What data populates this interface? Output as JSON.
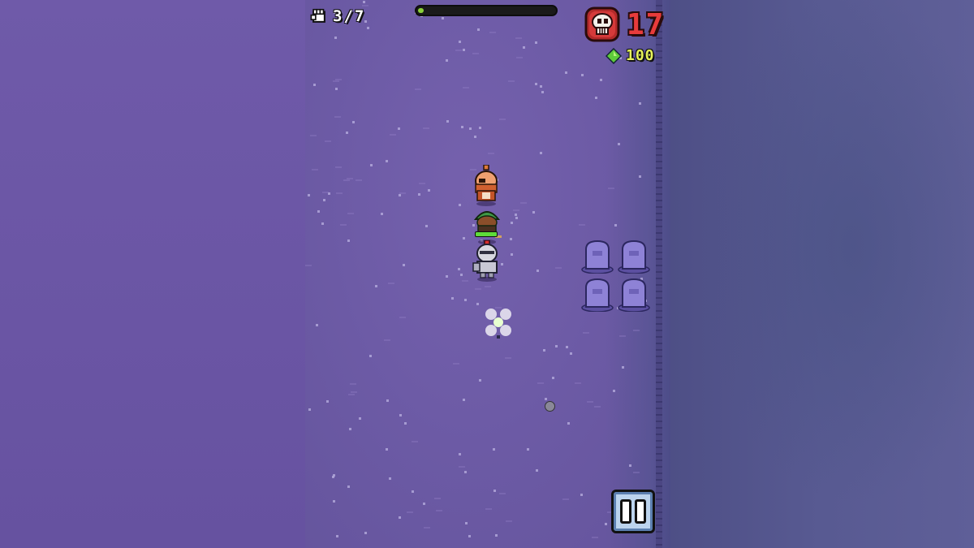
{
  "hud": {
    "power": "3/7",
    "level_progress": 0.04,
    "kills": "17",
    "gems": "100"
  },
  "icons": {
    "power": "fist-icon",
    "kills": "skull-icon",
    "gems": "green-gem-icon",
    "pause": "pause-icon"
  },
  "colors": {
    "ground": "#6d5ba6",
    "kills_text": "#e83b3b",
    "gem": "#5ecb3a",
    "progress_fill": "#8ad13a",
    "pause_button": "#bcd4ee"
  }
}
